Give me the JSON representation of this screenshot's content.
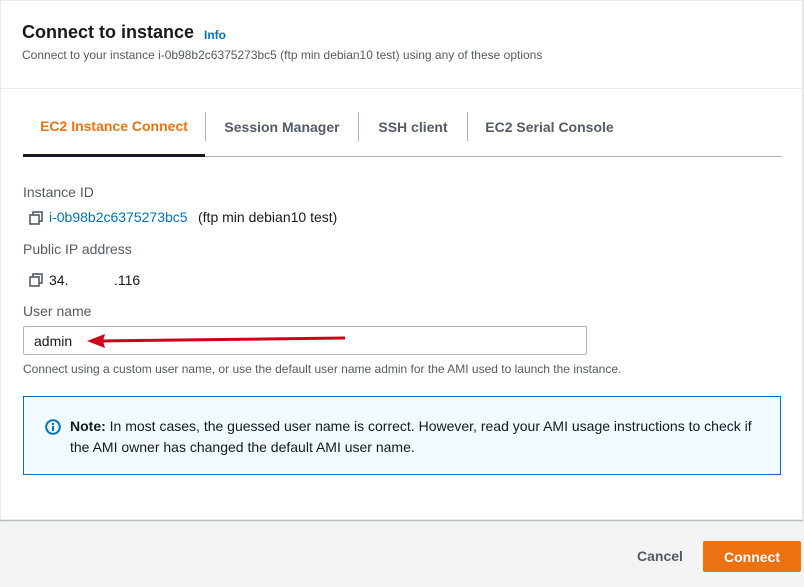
{
  "header": {
    "title": "Connect to instance",
    "info_link": "Info",
    "subtitle": "Connect to your instance i-0b98b2c6375273bc5 (ftp min debian10 test) using any of these options"
  },
  "tabs": [
    {
      "label": "EC2 Instance Connect",
      "active": true
    },
    {
      "label": "Session Manager",
      "active": false
    },
    {
      "label": "SSH client",
      "active": false
    },
    {
      "label": "EC2 Serial Console",
      "active": false
    }
  ],
  "instance": {
    "id_label": "Instance ID",
    "id_value": "i-0b98b2c6375273bc5",
    "id_name": "(ftp min debian10 test)",
    "ip_label": "Public IP address",
    "ip_value_start": "34.",
    "ip_value_end": ".116"
  },
  "username": {
    "label": "User name",
    "value": "admin",
    "hint": "Connect using a custom user name, or use the default user name admin for the AMI used to launch the instance."
  },
  "alert": {
    "prefix": "Note:",
    "text": " In most cases, the guessed user name is correct. However, read your AMI usage instructions to check if the AMI owner has changed the default AMI user name."
  },
  "footer": {
    "cancel_label": "Cancel",
    "connect_label": "Connect"
  },
  "colors": {
    "accent": "#ec7211",
    "link": "#0073bb",
    "annotation_arrow": "#d0021b"
  }
}
